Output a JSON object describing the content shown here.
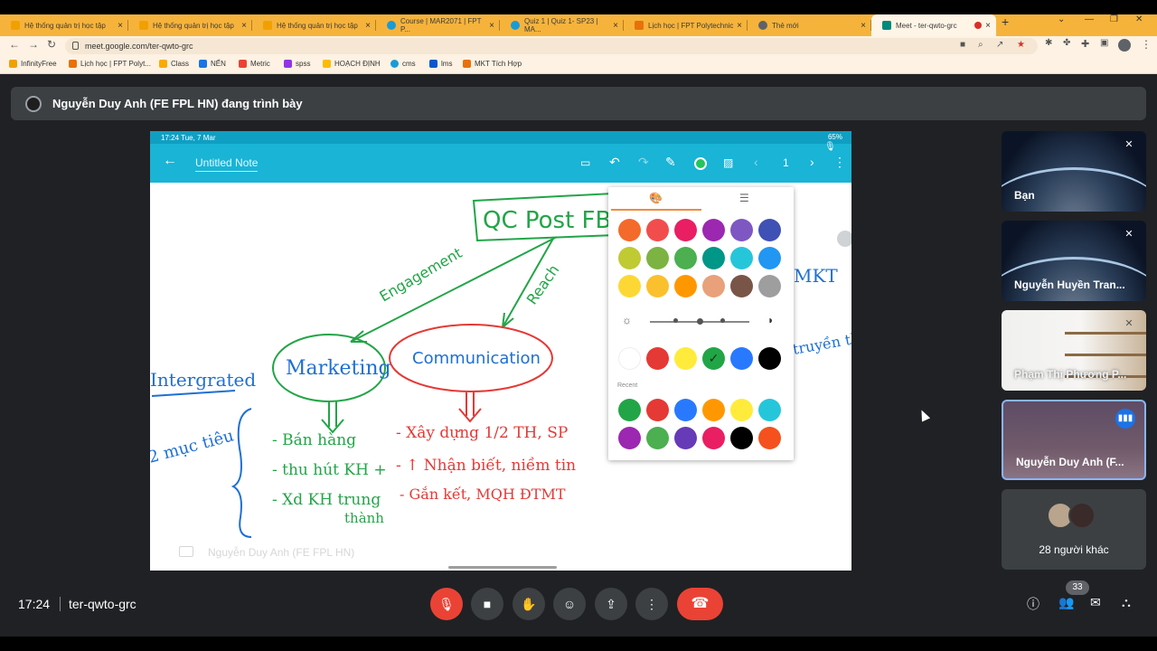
{
  "browser": {
    "tabs": [
      {
        "label": "Hệ thống quản trị học tập",
        "color": "#f0a100"
      },
      {
        "label": "Hệ thống quản trị học tập",
        "color": "#f0a100"
      },
      {
        "label": "Hệ thống quản trị học tập",
        "color": "#f0a100"
      },
      {
        "label": "Course | MAR2071 | FPT P...",
        "color": "#1a9bd7"
      },
      {
        "label": "Quiz 1 | Quiz 1- SP23 | MA...",
        "color": "#1a9bd7"
      },
      {
        "label": "Lịch học | FPT Polytechnic",
        "color": "#e8710a"
      },
      {
        "label": "Thẻ mới",
        "color": "#5f6368"
      },
      {
        "label": "Meet - ter-qwto-grc",
        "color": "#00897b"
      }
    ],
    "url": "meet.google.com/ter-qwto-grc",
    "bookmarks": [
      {
        "label": "InfinityFree",
        "color": "#f0a100"
      },
      {
        "label": "Lịch học | FPT Polyt...",
        "color": "#e8710a"
      },
      {
        "label": "Class",
        "color": "#f9ab00"
      },
      {
        "label": "NẾN",
        "color": "#1a73e8"
      },
      {
        "label": "Metric",
        "color": "#ea4335"
      },
      {
        "label": "spss",
        "color": "#9334e6"
      },
      {
        "label": "HOẠCH ĐỊNH",
        "color": "#fbbc04"
      },
      {
        "label": "cms",
        "color": "#1a9bd7"
      },
      {
        "label": "lms",
        "color": "#0b57d0"
      },
      {
        "label": "MKT Tích Hợp",
        "color": "#e8710a"
      }
    ]
  },
  "meet": {
    "presenting_banner": "Nguyễn Duy Anh (FE FPL HN) đang trình bày",
    "shared_screen": {
      "status_time": "17:24  Tue, 7 Mar",
      "status_right": "65%",
      "note_title": "Untitled Note",
      "page_number": "1",
      "recent_label": "Recent",
      "presenter_watermark": "Nguyễn Duy Anh (FE FPL HN)",
      "palette_colors": [
        [
          "#f46a2b",
          "#f24d4d",
          "#e91e63",
          "#9c27b0",
          "#7e57c2",
          "#3f51b5"
        ],
        [
          "#c0ca33",
          "#7cb342",
          "#4caf50",
          "#009688",
          "#26c6da",
          "#2196f3"
        ],
        [
          "#fdd835",
          "#fbc02d",
          "#ff9800",
          "#e8a17a",
          "#795548",
          "#9e9e9e"
        ]
      ],
      "quick_colors": [
        "#ffffff",
        "#e53935",
        "#ffeb3b",
        "#22a547",
        "#2979ff",
        "#000000"
      ],
      "recent_colors": [
        [
          "#22a547",
          "#e53935",
          "#2979ff",
          "#ff9800",
          "#ffeb3b",
          "#26c6da"
        ],
        [
          "#9c27b0",
          "#4caf50",
          "#673ab7",
          "#e91e63",
          "#000000",
          "#f4511e"
        ]
      ],
      "handwriting": {
        "top_box": "QC Post FB",
        "left_arrow": "Engagement",
        "right_arrow": "Reach",
        "integrated": "Intergrated",
        "marketing": "Marketing",
        "communication": "Communication",
        "muc_tieu": "2 mục tiêu",
        "left_list": [
          "- Bán hàng",
          "- thu hút KH +",
          "- Xd KH trung",
          "thành"
        ],
        "right_list": [
          "- Xây dựng 1/2 TH, SP",
          "- ↑ Nhận biết, niềm tin",
          "- Gắn kết, MQH ĐTMT"
        ],
        "mkt": "MKT",
        "truyen_th": "truyền th"
      }
    },
    "participants": [
      {
        "name": "Bạn"
      },
      {
        "name": "Nguyễn Huyền Tran..."
      },
      {
        "name": "Phạm Thị Phương P..."
      },
      {
        "name": "Nguyễn Duy Anh (F..."
      }
    ],
    "others_label": "28 người khác",
    "time": "17:24",
    "meeting_code": "ter-qwto-grc",
    "people_count": "33"
  }
}
